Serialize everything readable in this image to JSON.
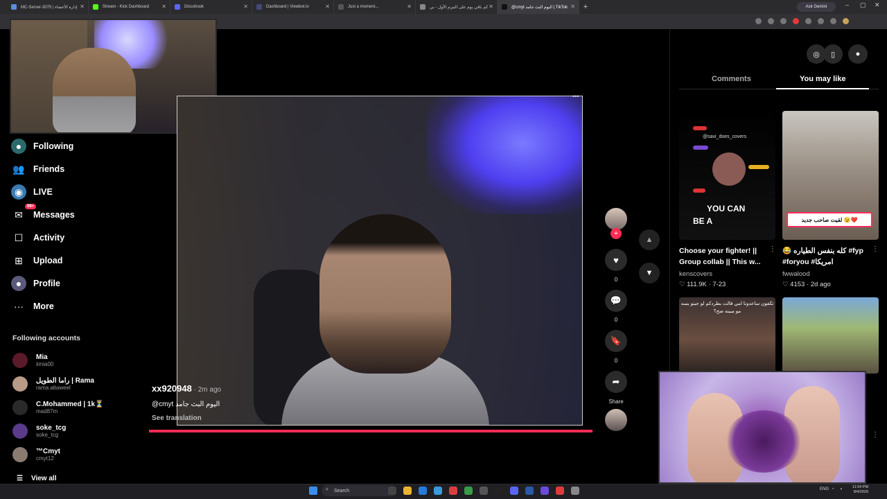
{
  "browser": {
    "tabs": [
      {
        "label": "MC-Server-3075 | إدارة الأعضاء",
        "color": "#5a8de0",
        "active": false
      },
      {
        "label": "Stream - Kick Dashboard",
        "color": "#53fc18",
        "active": false
      },
      {
        "label": "Discohook",
        "color": "#5865f2",
        "active": false
      },
      {
        "label": "Dashboard | Viewbot.tv",
        "color": "#444a7a",
        "active": false
      },
      {
        "label": "Just a moment...",
        "color": "#555",
        "active": false
      },
      {
        "label": "كم باقي يوم على التيرم الأول - بي",
        "color": "#888",
        "active": false
      },
      {
        "label": "@cmyt اليوم البث جامد | TikTok",
        "color": "#111",
        "active": true
      }
    ],
    "new_tab": "+",
    "ask_gemini": "Ask Gemini",
    "win_min": "–",
    "win_max": "▢",
    "win_close": "✕"
  },
  "sidebar": {
    "items": [
      {
        "label": "Following",
        "icon": "following-avatar-icon"
      },
      {
        "label": "Friends",
        "icon": "friends-icon"
      },
      {
        "label": "LIVE",
        "icon": "live-icon"
      },
      {
        "label": "Messages",
        "icon": "messages-icon",
        "badge": "99+"
      },
      {
        "label": "Activity",
        "icon": "activity-icon"
      },
      {
        "label": "Upload",
        "icon": "upload-icon"
      },
      {
        "label": "Profile",
        "icon": "profile-icon"
      },
      {
        "label": "More",
        "icon": "more-icon"
      }
    ],
    "following_title": "Following accounts",
    "accounts": [
      {
        "name": "Mia",
        "handle": "iimia00",
        "color": "#5a1a2a"
      },
      {
        "name": "راما الطويل | Rama",
        "handle": "rama.altaweel",
        "color": "#b89a86"
      },
      {
        "name": "C.Mohammed | 1k⏳",
        "handle": "mad87m",
        "color": "#2a2a2a"
      },
      {
        "name": "soke_tcg",
        "handle": "soke_tcg",
        "color": "#5a3a8a"
      },
      {
        "name": "™Cmyt",
        "handle": "cmyt12",
        "color": "#8a7a70"
      }
    ],
    "view_all": "View all"
  },
  "video": {
    "username": "xx920948",
    "ago": " · 2m ago",
    "description": "@cmyt اليوم البث جامد",
    "see_translation": "See translation",
    "progress": 1.0,
    "likes": "0",
    "comments": "0",
    "saves": "0",
    "share_label": "Share"
  },
  "right_panel": {
    "tabs": [
      "Comments",
      "You may like"
    ],
    "active_tab": 1,
    "cards": [
      {
        "title": "Choose your fighter! || Group collab || This w...",
        "author": "kenscovers",
        "views": "111.9K",
        "date": "7-23",
        "overlay_top": "@savi_does_covers",
        "overlay_a": "YOU CAN",
        "overlay_b": "BE A"
      },
      {
        "title": "😂 كله بنفس الطياره #fyp #foryou #امريكا",
        "author": "fwwalood",
        "views": "4153",
        "date": "2d ago",
        "overlay": "لقيت صاحب جديد 😉❤️"
      },
      {
        "overlay": "تكفون ساعدونا امي قالت بطردكم لو جبتو بسه مو مبينه صح؟"
      },
      {}
    ]
  },
  "taskbar": {
    "search": "Search",
    "lang": "ENG",
    "time": "11:54 PM",
    "date": "8/4/2026"
  }
}
